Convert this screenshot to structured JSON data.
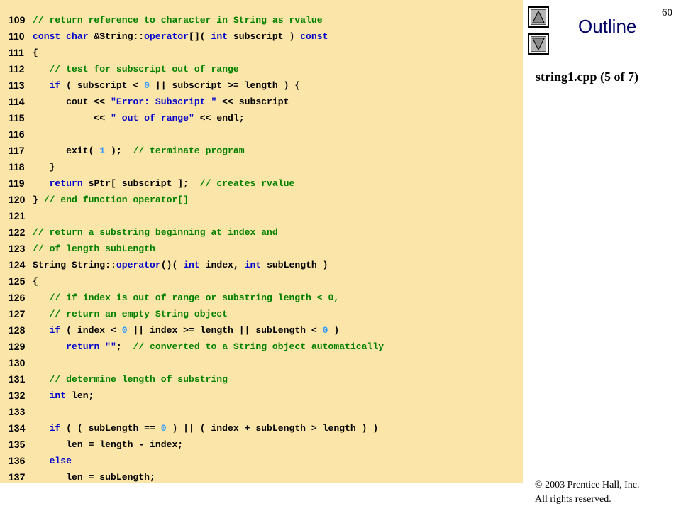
{
  "slide_number": "60",
  "outline": {
    "title": "Outline",
    "up_icon": "triangle-up",
    "down_icon": "triangle-down"
  },
  "file_label": "string1.cpp (5 of 7)",
  "copyright": {
    "line1": "© 2003 Prentice Hall, Inc.",
    "line2": "All rights reserved."
  },
  "colors": {
    "panel_bg": "#fbe5a8",
    "keyword": "#0000cc",
    "comment": "#008000",
    "number": "#3399ff",
    "outline_title": "#000066"
  },
  "code_lines": [
    {
      "num": "109",
      "tokens": [
        {
          "t": "c",
          "v": "// return reference to character in String as rvalue"
        }
      ]
    },
    {
      "num": "110",
      "tokens": [
        {
          "t": "k",
          "v": "const char"
        },
        {
          "t": "p",
          "v": " &String::"
        },
        {
          "t": "k",
          "v": "operator"
        },
        {
          "t": "p",
          "v": "[]( "
        },
        {
          "t": "k",
          "v": "int"
        },
        {
          "t": "p",
          "v": " subscript ) "
        },
        {
          "t": "k",
          "v": "const"
        }
      ]
    },
    {
      "num": "111",
      "tokens": [
        {
          "t": "p",
          "v": "{"
        }
      ]
    },
    {
      "num": "112",
      "tokens": [
        {
          "t": "p",
          "v": "   "
        },
        {
          "t": "c",
          "v": "// test for subscript out of range"
        }
      ]
    },
    {
      "num": "113",
      "tokens": [
        {
          "t": "p",
          "v": "   "
        },
        {
          "t": "k",
          "v": "if"
        },
        {
          "t": "p",
          "v": " ( subscript < "
        },
        {
          "t": "n",
          "v": "0"
        },
        {
          "t": "p",
          "v": " || subscript >= length ) {"
        }
      ]
    },
    {
      "num": "114",
      "tokens": [
        {
          "t": "p",
          "v": "      cout << "
        },
        {
          "t": "s",
          "v": "\"Error: Subscript \""
        },
        {
          "t": "p",
          "v": " << subscript"
        }
      ]
    },
    {
      "num": "115",
      "tokens": [
        {
          "t": "p",
          "v": "           << "
        },
        {
          "t": "s",
          "v": "\" out of range\""
        },
        {
          "t": "p",
          "v": " << endl;"
        }
      ]
    },
    {
      "num": "116",
      "tokens": []
    },
    {
      "num": "117",
      "tokens": [
        {
          "t": "p",
          "v": "      exit( "
        },
        {
          "t": "n",
          "v": "1"
        },
        {
          "t": "p",
          "v": " );  "
        },
        {
          "t": "c",
          "v": "// terminate program"
        }
      ]
    },
    {
      "num": "118",
      "tokens": [
        {
          "t": "p",
          "v": "   }"
        }
      ]
    },
    {
      "num": "119",
      "tokens": [
        {
          "t": "p",
          "v": "   "
        },
        {
          "t": "k",
          "v": "return"
        },
        {
          "t": "p",
          "v": " sPtr[ subscript ];  "
        },
        {
          "t": "c",
          "v": "// creates rvalue"
        }
      ]
    },
    {
      "num": "120",
      "tokens": [
        {
          "t": "p",
          "v": "} "
        },
        {
          "t": "c",
          "v": "// end function operator[]"
        }
      ]
    },
    {
      "num": "121",
      "tokens": []
    },
    {
      "num": "122",
      "tokens": [
        {
          "t": "c",
          "v": "// return a substring beginning at index and"
        }
      ]
    },
    {
      "num": "123",
      "tokens": [
        {
          "t": "c",
          "v": "// of length subLength"
        }
      ]
    },
    {
      "num": "124",
      "tokens": [
        {
          "t": "p",
          "v": "String String::"
        },
        {
          "t": "k",
          "v": "operator"
        },
        {
          "t": "p",
          "v": "()( "
        },
        {
          "t": "k",
          "v": "int"
        },
        {
          "t": "p",
          "v": " index, "
        },
        {
          "t": "k",
          "v": "int"
        },
        {
          "t": "p",
          "v": " subLength )"
        }
      ]
    },
    {
      "num": "125",
      "tokens": [
        {
          "t": "p",
          "v": "{"
        }
      ]
    },
    {
      "num": "126",
      "tokens": [
        {
          "t": "p",
          "v": "   "
        },
        {
          "t": "c",
          "v": "// if index is out of range or substring length < 0,"
        }
      ]
    },
    {
      "num": "127",
      "tokens": [
        {
          "t": "p",
          "v": "   "
        },
        {
          "t": "c",
          "v": "// return an empty String object"
        }
      ]
    },
    {
      "num": "128",
      "tokens": [
        {
          "t": "p",
          "v": "   "
        },
        {
          "t": "k",
          "v": "if"
        },
        {
          "t": "p",
          "v": " ( index < "
        },
        {
          "t": "n",
          "v": "0"
        },
        {
          "t": "p",
          "v": " || index >= length || subLength < "
        },
        {
          "t": "n",
          "v": "0"
        },
        {
          "t": "p",
          "v": " )"
        }
      ]
    },
    {
      "num": "129",
      "tokens": [
        {
          "t": "p",
          "v": "      "
        },
        {
          "t": "k",
          "v": "return"
        },
        {
          "t": "p",
          "v": " "
        },
        {
          "t": "s",
          "v": "\"\""
        },
        {
          "t": "p",
          "v": ";  "
        },
        {
          "t": "c",
          "v": "// converted to a String object automatically"
        }
      ]
    },
    {
      "num": "130",
      "tokens": []
    },
    {
      "num": "131",
      "tokens": [
        {
          "t": "p",
          "v": "   "
        },
        {
          "t": "c",
          "v": "// determine length of substring"
        }
      ]
    },
    {
      "num": "132",
      "tokens": [
        {
          "t": "p",
          "v": "   "
        },
        {
          "t": "k",
          "v": "int"
        },
        {
          "t": "p",
          "v": " len;"
        }
      ]
    },
    {
      "num": "133",
      "tokens": []
    },
    {
      "num": "134",
      "tokens": [
        {
          "t": "p",
          "v": "   "
        },
        {
          "t": "k",
          "v": "if"
        },
        {
          "t": "p",
          "v": " ( ( subLength == "
        },
        {
          "t": "n",
          "v": "0"
        },
        {
          "t": "p",
          "v": " ) || ( index + subLength > length ) )"
        }
      ]
    },
    {
      "num": "135",
      "tokens": [
        {
          "t": "p",
          "v": "      len = length - index;"
        }
      ]
    },
    {
      "num": "136",
      "tokens": [
        {
          "t": "p",
          "v": "   "
        },
        {
          "t": "k",
          "v": "else"
        }
      ]
    },
    {
      "num": "137",
      "tokens": [
        {
          "t": "p",
          "v": "      len = subLength;"
        }
      ]
    }
  ]
}
